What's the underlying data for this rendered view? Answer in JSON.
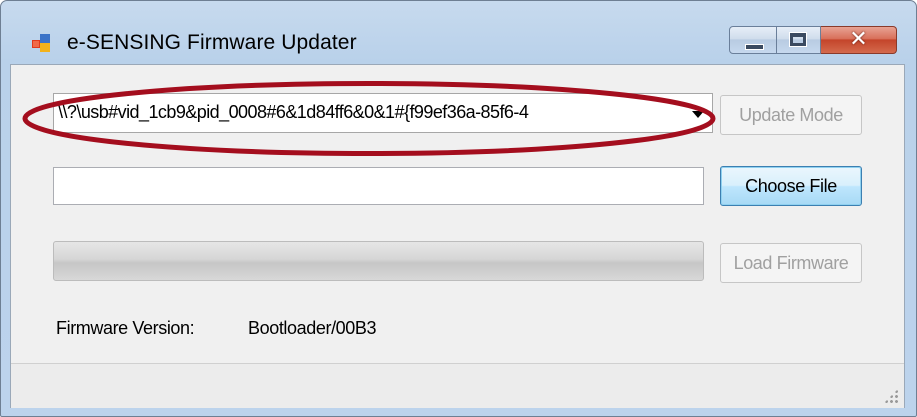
{
  "window": {
    "title": "e-SENSING Firmware Updater",
    "icon": "app-window-icon",
    "controls": [
      "minimize-icon",
      "maximize-icon",
      "close-icon"
    ],
    "close_glyph": "✕"
  },
  "device_selector": {
    "selected_value": "\\\\?\\usb#vid_1cb9&pid_0008#6&1d84ff6&0&1#{f99ef36a-85f6-4",
    "icon": "chevron-down-icon"
  },
  "buttons": {
    "update_mode": "Update Mode",
    "choose_file": "Choose File",
    "load_firmware": "Load Firmware"
  },
  "file_path": {
    "value": ""
  },
  "progress": {
    "fraction": 0
  },
  "firmware": {
    "label": "Firmware Version:",
    "value": "Bootloader/00B3"
  },
  "annotation": {
    "color": "#a40e1e"
  },
  "statusbar": {
    "icon": "size-grip-icon"
  }
}
